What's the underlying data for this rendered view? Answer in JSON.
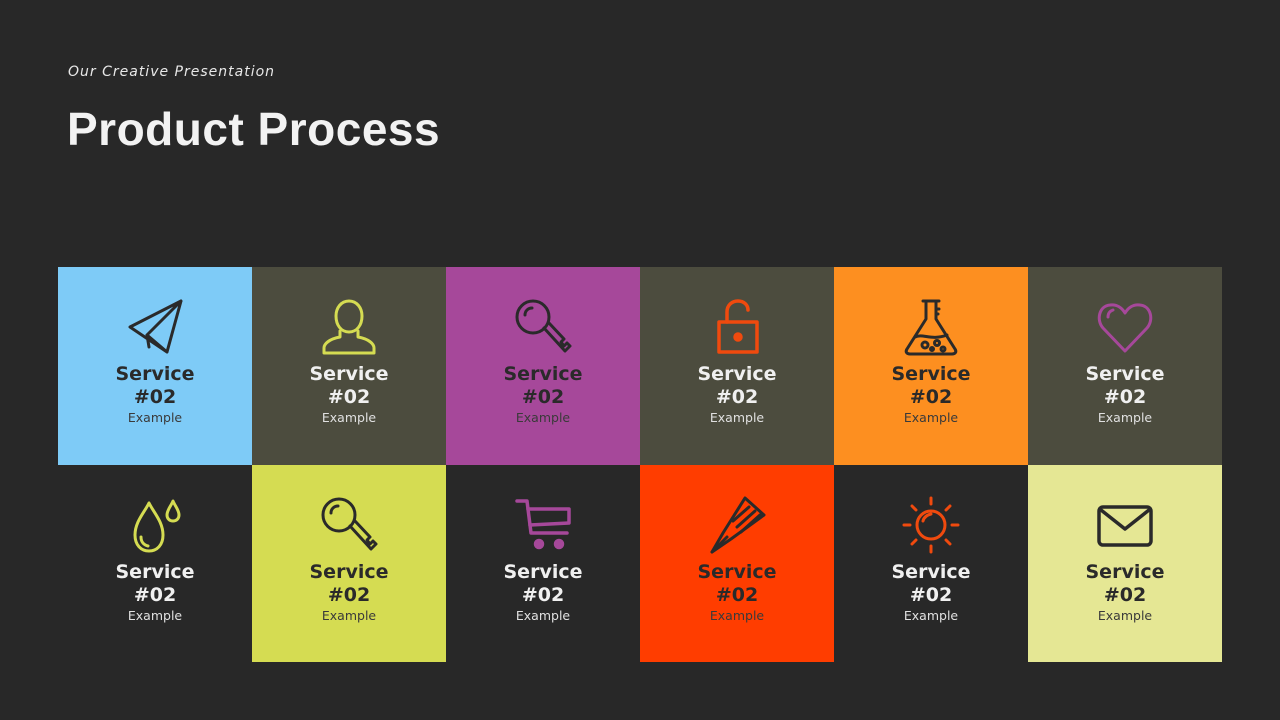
{
  "header": {
    "subtitle": "Our Creative Presentation",
    "title": "Product Process"
  },
  "tiles": [
    {
      "service": "Service",
      "number": "#02",
      "sub": "Example",
      "icon": "paper-plane-icon",
      "bg": "#7ecbf7",
      "icon_color": "#2a2a2a",
      "text": "dark"
    },
    {
      "service": "Service",
      "number": "#02",
      "sub": "Example",
      "icon": "user-icon",
      "bg": "#4c4c3e",
      "icon_color": "#d5dc52",
      "text": "light"
    },
    {
      "service": "Service",
      "number": "#02",
      "sub": "Example",
      "icon": "key-icon",
      "bg": "#a6489a",
      "icon_color": "#2a2a2a",
      "text": "dark"
    },
    {
      "service": "Service",
      "number": "#02",
      "sub": "Example",
      "icon": "unlock-icon",
      "bg": "#4c4c3e",
      "icon_color": "#f04a0e",
      "text": "light"
    },
    {
      "service": "Service",
      "number": "#02",
      "sub": "Example",
      "icon": "flask-icon",
      "bg": "#fd8f20",
      "icon_color": "#2a2a2a",
      "text": "dark"
    },
    {
      "service": "Service",
      "number": "#02",
      "sub": "Example",
      "icon": "heart-icon",
      "bg": "#4c4c3e",
      "icon_color": "#a6489a",
      "text": "light"
    },
    {
      "service": "Service",
      "number": "#02",
      "sub": "Example",
      "icon": "water-drops-icon",
      "bg": "#282828",
      "icon_color": "#d5dc52",
      "text": "light"
    },
    {
      "service": "Service",
      "number": "#02",
      "sub": "Example",
      "icon": "key-icon",
      "bg": "#d5dc52",
      "icon_color": "#2a2a2a",
      "text": "dark"
    },
    {
      "service": "Service",
      "number": "#02",
      "sub": "Example",
      "icon": "shopping-cart-icon",
      "bg": "#282828",
      "icon_color": "#a6489a",
      "text": "light"
    },
    {
      "service": "Service",
      "number": "#02",
      "sub": "Example",
      "icon": "pen-nib-icon",
      "bg": "#ff3d00",
      "icon_color": "#2a2a2a",
      "text": "dark"
    },
    {
      "service": "Service",
      "number": "#02",
      "sub": "Example",
      "icon": "sun-icon",
      "bg": "#282828",
      "icon_color": "#f04a0e",
      "text": "light"
    },
    {
      "service": "Service",
      "number": "#02",
      "sub": "Example",
      "icon": "envelope-icon",
      "bg": "#e5e794",
      "icon_color": "#2a2a2a",
      "text": "dark"
    }
  ]
}
